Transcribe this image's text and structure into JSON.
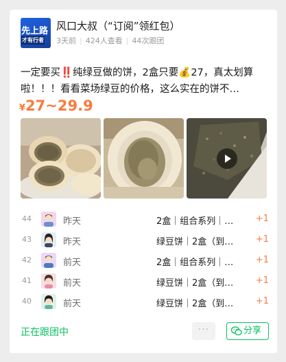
{
  "header": {
    "avatar_line1": "先上路",
    "avatar_line2": "才有行者",
    "title": "风口大叔（“订阅”领红包）",
    "time": "3天前",
    "views": "424人查看",
    "followers": "44次跟团"
  },
  "description": "一定要买‼️纯绿豆做的饼，2盒只要💰27，真太划算啦！！！看看菜场绿豆的价格，这么实在的饼不…",
  "price": {
    "currency": "¥",
    "range": "27~29.9"
  },
  "images": [
    {
      "name": "mung-bean-cakes-plate"
    },
    {
      "name": "mung-bean-cake-cross-section"
    },
    {
      "name": "mung-bean-video-thumbnail",
      "video": true
    }
  ],
  "orders": [
    {
      "num": "44",
      "day": "昨天",
      "item": "2盒｜组合系列｜…",
      "qty": "+1"
    },
    {
      "num": "43",
      "day": "昨天",
      "item": "绿豆饼｜2盒（到…",
      "qty": "+1"
    },
    {
      "num": "42",
      "day": "前天",
      "item": "2盒｜组合系列｜…",
      "qty": "+1"
    },
    {
      "num": "41",
      "day": "前天",
      "item": "绿豆饼｜2盒（到…",
      "qty": "+1"
    },
    {
      "num": "40",
      "day": "前天",
      "item": "绿豆饼｜2盒（到…",
      "qty": "+1"
    }
  ],
  "footer": {
    "status": "正在跟团中",
    "more": "···",
    "share": "分享"
  },
  "colors": {
    "accent_green": "#07c160",
    "price_orange": "#fa7a3d"
  }
}
